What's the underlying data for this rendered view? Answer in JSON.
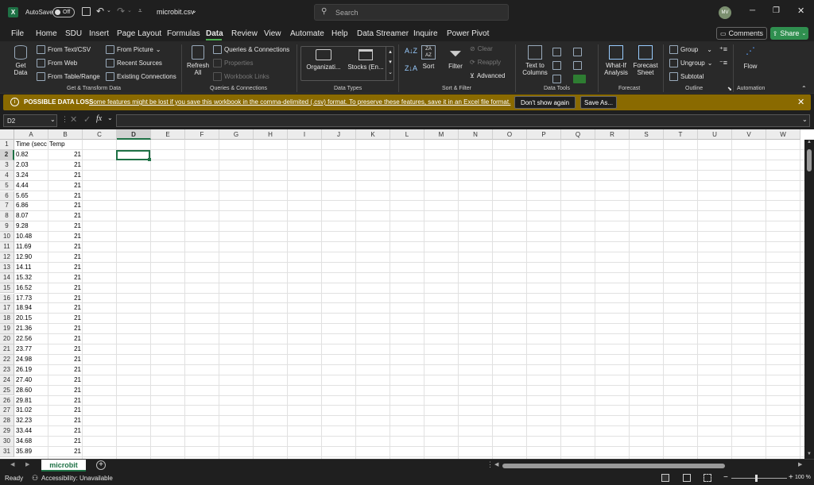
{
  "titlebar": {
    "autosave_label": "AutoSave",
    "autosave_state": "Off",
    "filename": "microbit.csv",
    "search_placeholder": "Search",
    "user_initials": "MV"
  },
  "menu": [
    "File",
    "Home",
    "SDU",
    "Insert",
    "Page Layout",
    "Formulas",
    "Data",
    "Review",
    "View",
    "Automate",
    "Help",
    "Data Streamer",
    "Inquire",
    "Power Pivot"
  ],
  "menu_active": "Data",
  "comments_label": "Comments",
  "share_label": "Share",
  "ribbon": {
    "get_data": [
      "Get",
      "Data"
    ],
    "from_text_csv": "From Text/CSV",
    "from_web": "From Web",
    "from_table_range": "From Table/Range",
    "from_picture": "From Picture",
    "recent_sources": "Recent Sources",
    "existing_connections": "Existing Connections",
    "group_get_transform": "Get & Transform Data",
    "refresh_all": [
      "Refresh",
      "All"
    ],
    "queries_connections": "Queries & Connections",
    "properties": "Properties",
    "workbook_links": "Workbook Links",
    "group_queries": "Queries & Connections",
    "organization": "Organizati...",
    "stocks": "Stocks (En...",
    "group_data_types": "Data Types",
    "sort": "Sort",
    "filter": "Filter",
    "clear": "Clear",
    "reapply": "Reapply",
    "advanced": "Advanced",
    "group_sort_filter": "Sort & Filter",
    "text_to_columns": [
      "Text to",
      "Columns"
    ],
    "group_data_tools": "Data Tools",
    "what_if": [
      "What-If",
      "Analysis"
    ],
    "forecast_sheet": [
      "Forecast",
      "Sheet"
    ],
    "group_forecast": "Forecast",
    "group_btn": "Group",
    "ungroup_btn": "Ungroup",
    "subtotal_btn": "Subtotal",
    "group_outline": "Outline",
    "flow": "Flow",
    "group_automation": "Automation"
  },
  "message_bar": {
    "title": "POSSIBLE DATA LOSS",
    "text": "Some features might be lost if you save this workbook in the comma-delimited (.csv) format. To preserve these features, save it in an Excel file format.",
    "dont_show": "Don't show again",
    "save_as": "Save As..."
  },
  "name_box": "D2",
  "fx_label": "fx",
  "columns": [
    "A",
    "B",
    "C",
    "D",
    "E",
    "F",
    "G",
    "H",
    "I",
    "J",
    "K",
    "L",
    "M",
    "N",
    "O",
    "P",
    "Q",
    "R",
    "S",
    "T",
    "U",
    "V",
    "W"
  ],
  "selected_cell": "D2",
  "headers": [
    "Time (secc",
    "Temp"
  ],
  "rows": [
    [
      "0.82",
      "21"
    ],
    [
      "2.03",
      "21"
    ],
    [
      "3.24",
      "21"
    ],
    [
      "4.44",
      "21"
    ],
    [
      "5.65",
      "21"
    ],
    [
      "6.86",
      "21"
    ],
    [
      "8.07",
      "21"
    ],
    [
      "9.28",
      "21"
    ],
    [
      "10.48",
      "21"
    ],
    [
      "11.69",
      "21"
    ],
    [
      "12.90",
      "21"
    ],
    [
      "14.11",
      "21"
    ],
    [
      "15.32",
      "21"
    ],
    [
      "16.52",
      "21"
    ],
    [
      "17.73",
      "21"
    ],
    [
      "18.94",
      "21"
    ],
    [
      "20.15",
      "21"
    ],
    [
      "21.36",
      "21"
    ],
    [
      "22.56",
      "21"
    ],
    [
      "23.77",
      "21"
    ],
    [
      "24.98",
      "21"
    ],
    [
      "26.19",
      "21"
    ],
    [
      "27.40",
      "21"
    ],
    [
      "28.60",
      "21"
    ],
    [
      "29.81",
      "21"
    ],
    [
      "31.02",
      "21"
    ],
    [
      "32.23",
      "21"
    ],
    [
      "33.44",
      "21"
    ],
    [
      "34.68",
      "21"
    ],
    [
      "35.89",
      "21"
    ]
  ],
  "sheet_tab": "microbit",
  "status": {
    "ready": "Ready",
    "accessibility": "Accessibility: Unavailable",
    "zoom": "100 %"
  },
  "colors": {
    "accent_green": "#1e7145",
    "share_green": "#2f8f4f",
    "warning_bar": "#8a6a00"
  }
}
